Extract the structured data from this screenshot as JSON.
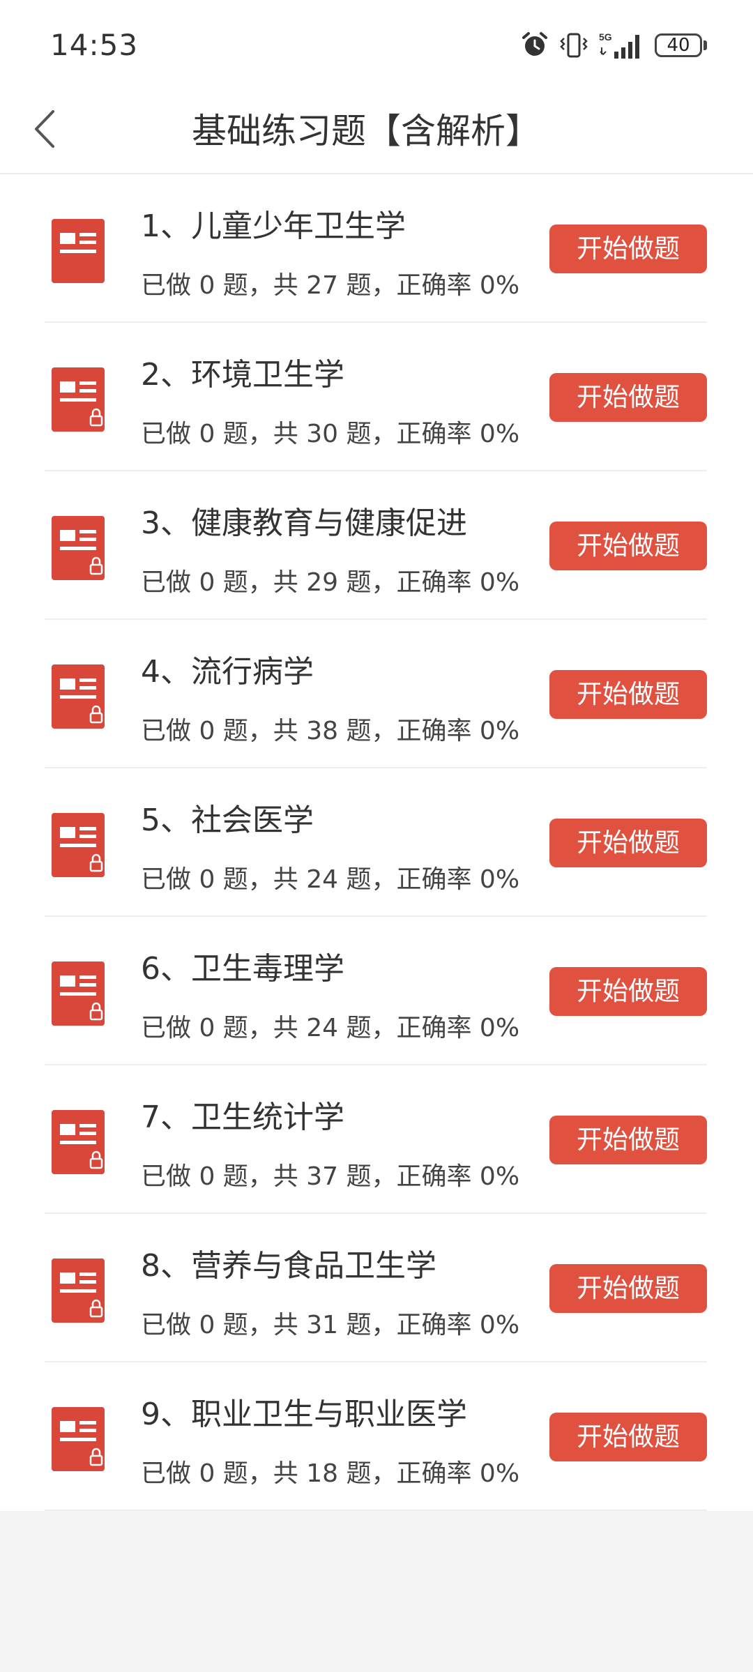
{
  "status_bar": {
    "time": "14:53",
    "battery_level": "40",
    "network": "5G"
  },
  "header": {
    "title": "基础练习题【含解析】"
  },
  "list": {
    "button_label": "开始做题",
    "items": [
      {
        "title": "1、儿童少年卫生学",
        "stats": "已做 0 题，共 27 题，正确率 0%",
        "locked": false
      },
      {
        "title": "2、环境卫生学",
        "stats": "已做 0 题，共 30 题，正确率 0%",
        "locked": true
      },
      {
        "title": "3、健康教育与健康促进",
        "stats": "已做 0 题，共 29 题，正确率 0%",
        "locked": true
      },
      {
        "title": "4、流行病学",
        "stats": "已做 0 题，共 38 题，正确率 0%",
        "locked": true
      },
      {
        "title": "5、社会医学",
        "stats": "已做 0 题，共 24 题，正确率 0%",
        "locked": true
      },
      {
        "title": "6、卫生毒理学",
        "stats": "已做 0 题，共 24 题，正确率 0%",
        "locked": true
      },
      {
        "title": "7、卫生统计学",
        "stats": "已做 0 题，共 37 题，正确率 0%",
        "locked": true
      },
      {
        "title": "8、营养与食品卫生学",
        "stats": "已做 0 题，共 31 题，正确率 0%",
        "locked": true
      },
      {
        "title": "9、职业卫生与职业医学",
        "stats": "已做 0 题，共 18 题，正确率 0%",
        "locked": true
      }
    ]
  },
  "colors": {
    "accent": "#e0513f",
    "icon": "#d9473a"
  },
  "icons": {
    "back": "chevron-left-icon",
    "document": "document-icon",
    "lock": "lock-icon"
  }
}
